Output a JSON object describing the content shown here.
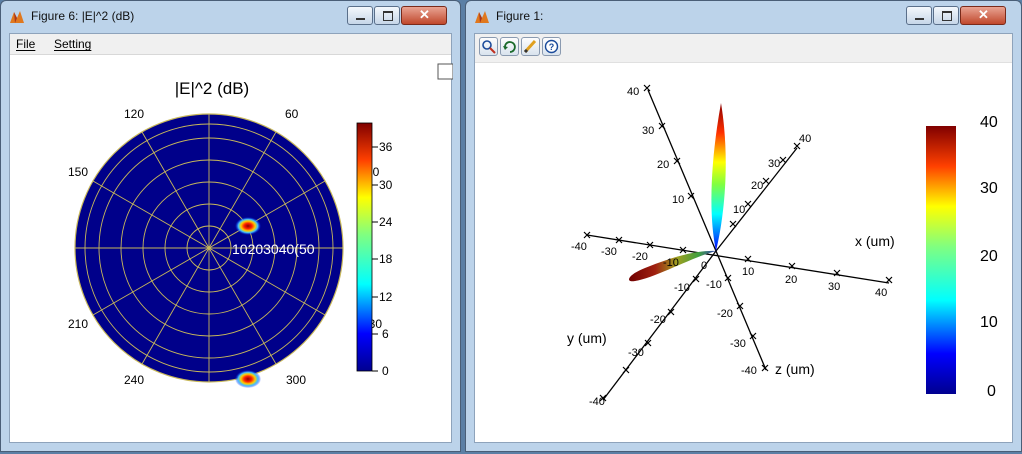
{
  "window1": {
    "title": "Figure 6: |E|^2 (dB)",
    "menu": {
      "file": "File",
      "setting": "Setting"
    },
    "plot_title": "|E|^2 (dB)",
    "angle_labels": [
      "30",
      "60",
      "120",
      "150",
      "210",
      "240",
      "300",
      "330"
    ],
    "radial_labels": "10203040(50",
    "colorbar_ticks": [
      "36",
      "30",
      "24",
      "18",
      "12",
      "6",
      "0"
    ]
  },
  "window2": {
    "title": "Figure 1:",
    "toolbar": [
      "zoom-icon",
      "rotate-icon",
      "pen-icon",
      "help-icon"
    ],
    "axes": {
      "x_label": "x (um)",
      "y_label": "y (um)",
      "z_label": "z (um)",
      "x_ticks": [
        "-40",
        "-30",
        "-20",
        "-10",
        "0",
        "10",
        "20",
        "30",
        "40"
      ],
      "vertical_ticks": [
        "40",
        "30",
        "20",
        "10"
      ],
      "diag_up_ticks": [
        "40",
        "30",
        "20",
        "10"
      ],
      "y_ticks": [
        "-10",
        "-20",
        "-30",
        "-40"
      ],
      "z_ticks": [
        "-10",
        "-20",
        "-30",
        "-40"
      ]
    },
    "colorbar_ticks": [
      "40",
      "30",
      "20",
      "10",
      "0"
    ]
  },
  "colors": {
    "polar_bg": "#00008a",
    "grid": "#c8b85a",
    "title_bar": "#bcd3ea"
  }
}
